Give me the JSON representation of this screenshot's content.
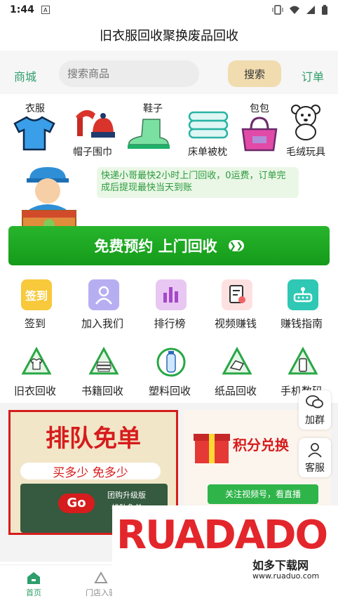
{
  "status": {
    "time": "1:44"
  },
  "title": "旧衣服回收聚换废品回收",
  "search": {
    "left_link": "商城",
    "placeholder": "搜索商品",
    "button": "搜索",
    "right_link": "订单"
  },
  "categories": [
    {
      "label": "衣服",
      "icon": "tshirt-icon"
    },
    {
      "label": "帽子围巾",
      "icon": "hat-scarf-icon"
    },
    {
      "label": "鞋子",
      "icon": "boot-icon"
    },
    {
      "label": "床单被枕",
      "icon": "bedsheet-icon"
    },
    {
      "label": "包包",
      "icon": "handbag-icon"
    },
    {
      "label": "毛绒玩具",
      "icon": "teddy-bear-icon"
    }
  ],
  "notice": "快递小哥最快2小时上门回收，0运费，订单完成后提现最快当天到账",
  "cta": "免费预约 上门回收",
  "menu_row1": [
    {
      "label": "签到",
      "icon": "checkin-icon",
      "badge": "签到"
    },
    {
      "label": "加入我们",
      "icon": "people-icon"
    },
    {
      "label": "排行榜",
      "icon": "ranking-icon"
    },
    {
      "label": "视频赚钱",
      "icon": "video-doc-icon"
    },
    {
      "label": "赚钱指南",
      "icon": "guide-icon"
    }
  ],
  "menu_row2": [
    {
      "label": "旧衣回收",
      "icon": "recycle-clothes-icon"
    },
    {
      "label": "书籍回收",
      "icon": "recycle-books-icon"
    },
    {
      "label": "塑料回收",
      "icon": "recycle-plastic-icon"
    },
    {
      "label": "纸品回收",
      "icon": "recycle-paper-icon"
    },
    {
      "label": "手机数码",
      "icon": "recycle-phone-icon"
    }
  ],
  "banner_left": {
    "headline": "排队免单",
    "line2": "买多少 免多少",
    "line3": "团购升级版",
    "line4": "排队免单",
    "go": "Go"
  },
  "banner_right": {
    "headline": "积分兑换",
    "sub": "关注视频号，看直播"
  },
  "float": {
    "group": "加群",
    "service": "客服"
  },
  "tabs": [
    {
      "label": "首页"
    },
    {
      "label": "门店入驻"
    }
  ],
  "watermark": {
    "brand": "RUADADO",
    "cn": "如多下载网",
    "url": "www.ruaduo.com"
  },
  "colors": {
    "accent": "#2e9e6a",
    "cta": "#1aa51f",
    "banner_red": "#d61c1c"
  }
}
